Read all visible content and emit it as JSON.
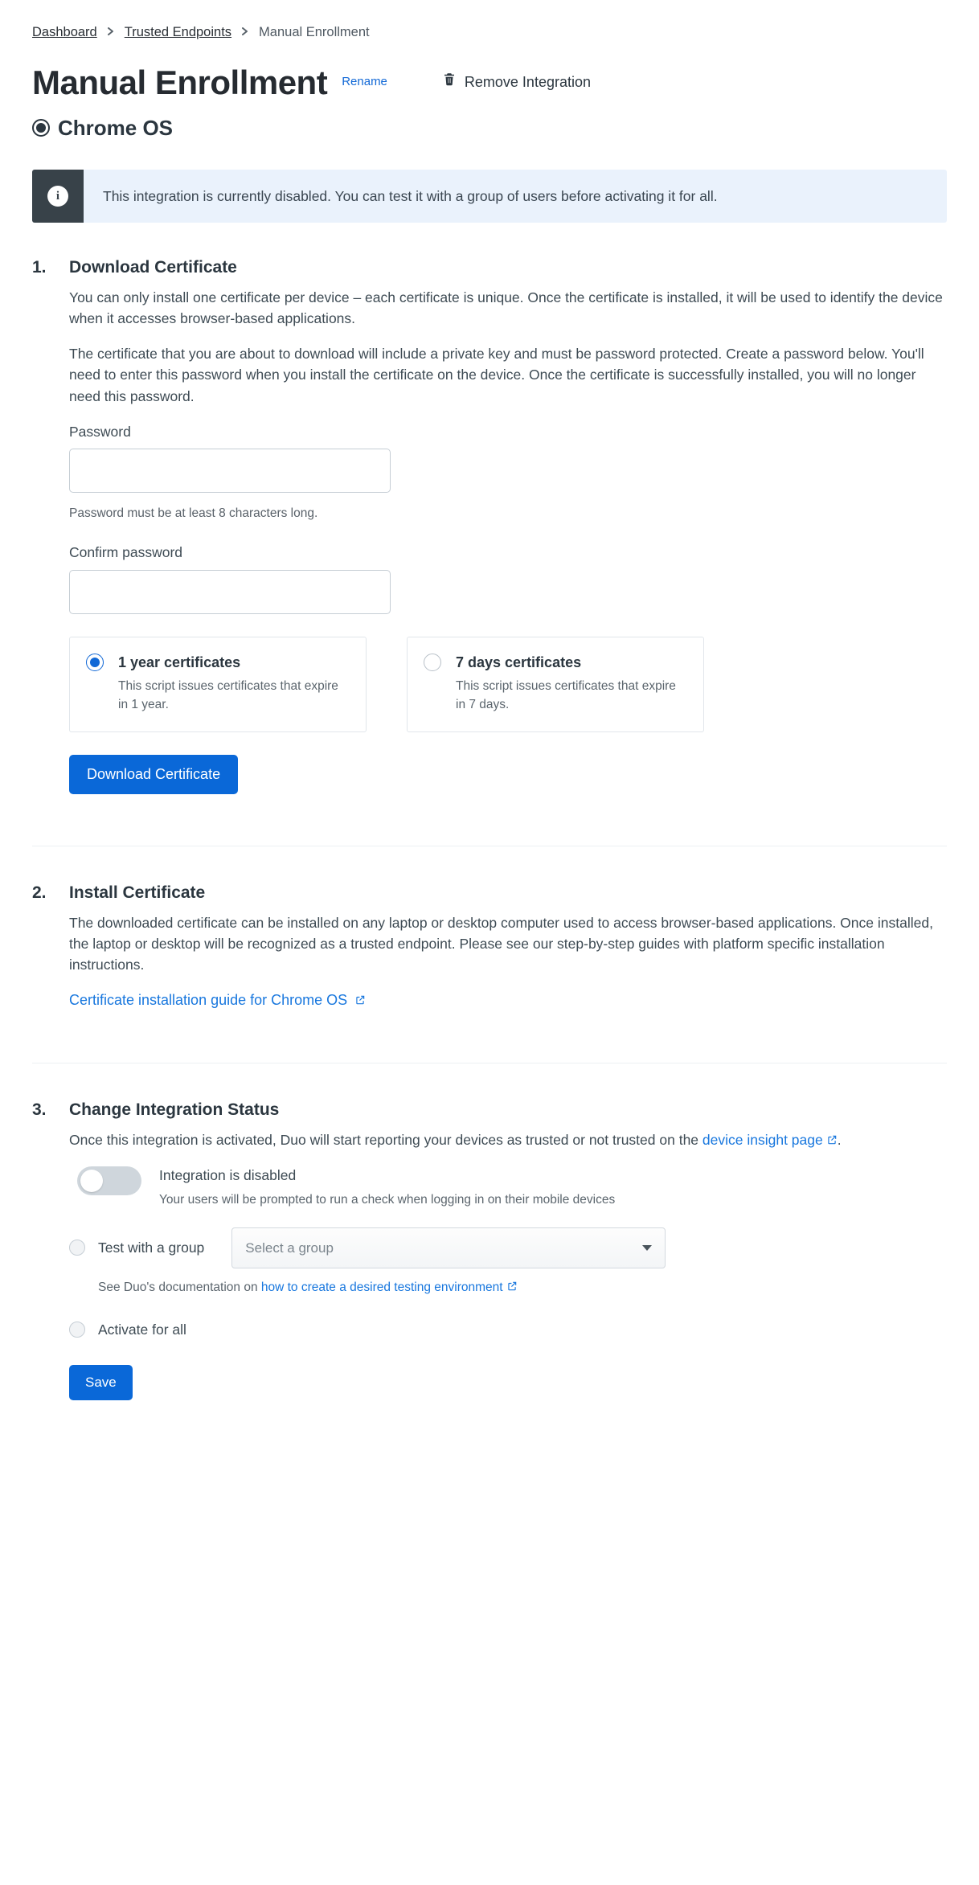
{
  "breadcrumb": {
    "items": [
      "Dashboard",
      "Trusted Endpoints"
    ],
    "current": "Manual Enrollment"
  },
  "header": {
    "title": "Manual Enrollment",
    "rename": "Rename",
    "remove": "Remove Integration",
    "os": "Chrome OS"
  },
  "banner": {
    "icon": "i",
    "message": "This integration is currently disabled. You can test it with a group of users before activating it for all."
  },
  "step1": {
    "num": "1.",
    "heading": "Download Certificate",
    "para1": "You can only install one certificate per device – each certificate is unique. Once the certificate is installed, it will be used to identify the device when it accesses browser-based applications.",
    "para2": "The certificate that you are about to download will include a private key and must be password protected. Create a password below. You'll need to enter this password when you install the certificate on the device. Once the certificate is successfully installed, you will no longer need this password.",
    "password_label": "Password",
    "password_hint": "Password must be at least 8 characters long.",
    "confirm_label": "Confirm password",
    "card1": {
      "title": "1 year certificates",
      "desc": "This script issues certificates that expire in 1 year."
    },
    "card2": {
      "title": "7 days certificates",
      "desc": "This script issues certificates that expire in 7 days."
    },
    "download_btn": "Download Certificate"
  },
  "step2": {
    "num": "2.",
    "heading": "Install Certificate",
    "para": "The downloaded certificate can be installed on any laptop or desktop computer used to access browser-based applications. Once installed, the laptop or desktop will be recognized as a trusted endpoint. Please see our step-by-step guides with platform specific installation instructions.",
    "guide_link": "Certificate installation guide for Chrome OS"
  },
  "step3": {
    "num": "3.",
    "heading": "Change Integration Status",
    "para_prefix": "Once this integration is activated, Duo will start reporting your devices as trusted or not trusted on the ",
    "para_link": "device insight page",
    "para_suffix": ".",
    "disabled_title": "Integration is disabled",
    "disabled_desc": "Your users will be prompted to run a check when logging in on their mobile devices",
    "test_label": "Test with a group",
    "select_placeholder": "Select a group",
    "doc_prefix": "See Duo's documentation on ",
    "doc_link": "how to create a desired testing environment",
    "activate_label": "Activate for all",
    "save_btn": "Save"
  }
}
